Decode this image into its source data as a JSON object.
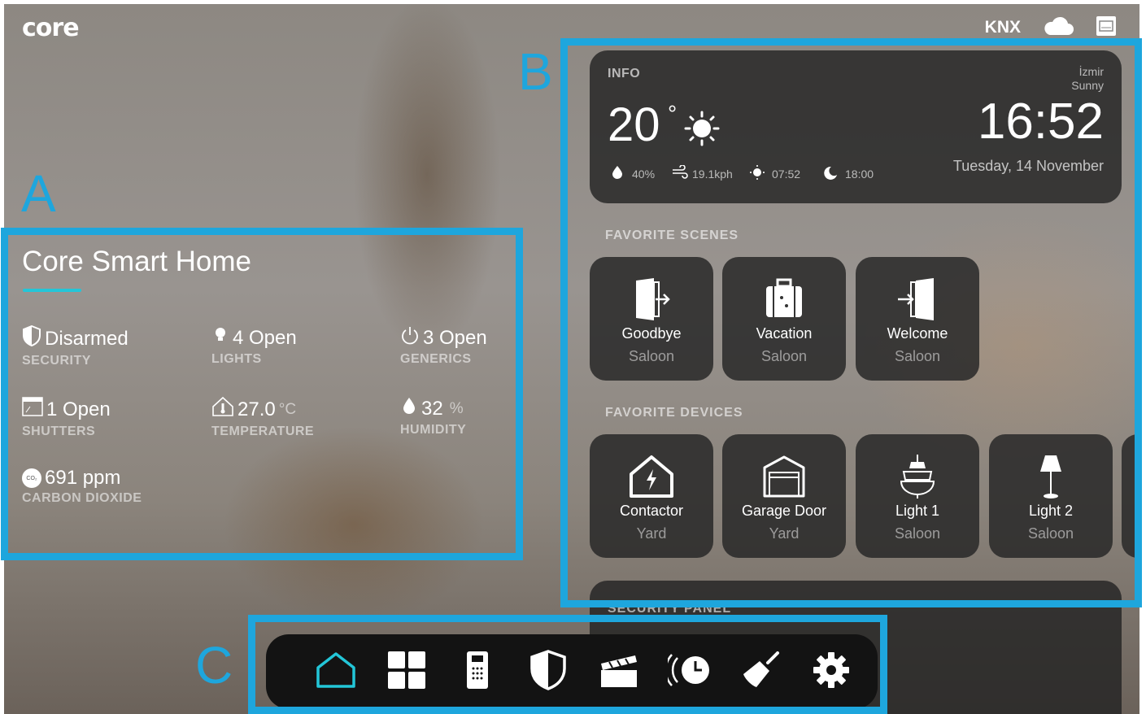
{
  "brand": {
    "logo": "core"
  },
  "status_bar": {
    "protocol": "KNX",
    "cloud_icon": "cloud-icon",
    "device_icon": "screen-icon"
  },
  "annotations": {
    "a": "A",
    "b": "B",
    "c": "C",
    "color": "#1ea6dd"
  },
  "home": {
    "title": "Core Smart Home",
    "accent": "#23c6d8",
    "stats": [
      {
        "value": "Disarmed",
        "unit": "",
        "label": "SECURITY",
        "icon": "shield-icon"
      },
      {
        "value": "4 Open",
        "unit": "",
        "label": "LIGHTS",
        "icon": "bulb-icon"
      },
      {
        "value": "3 Open",
        "unit": "",
        "label": "GENERICS",
        "icon": "power-icon"
      },
      {
        "value": "1 Open",
        "unit": "",
        "label": "SHUTTERS",
        "icon": "shutter-icon"
      },
      {
        "value": "27.0",
        "unit": "°C",
        "label": "TEMPERATURE",
        "icon": "house-thermometer-icon"
      },
      {
        "value": "32",
        "unit": "%",
        "label": "HUMIDITY",
        "icon": "drop-icon"
      },
      {
        "value": "691 ppm",
        "unit": "",
        "label": "CARBON DIOXIDE",
        "icon": "co2-icon",
        "badge": "CO₂"
      }
    ]
  },
  "info": {
    "header": "INFO",
    "city": "İzmir",
    "condition": "Sunny",
    "temperature": "20",
    "degree": "°",
    "humidity": "40%",
    "wind": "19.1kph",
    "sunrise": "07:52",
    "sunset": "18:00",
    "time": "16:52",
    "date": "Tuesday, 14 November"
  },
  "favorite_scenes": {
    "header": "FAVORITE SCENES",
    "items": [
      {
        "name": "Goodbye",
        "location": "Saloon",
        "icon": "door-exit-icon"
      },
      {
        "name": "Vacation",
        "location": "Saloon",
        "icon": "suitcase-icon"
      },
      {
        "name": "Welcome",
        "location": "Saloon",
        "icon": "door-enter-icon"
      }
    ]
  },
  "favorite_devices": {
    "header": "FAVORITE DEVICES",
    "items": [
      {
        "name": "Contactor",
        "location": "Yard",
        "icon": "house-bolt-icon"
      },
      {
        "name": "Garage Door",
        "location": "Yard",
        "icon": "garage-icon"
      },
      {
        "name": "Light 1",
        "location": "Saloon",
        "icon": "chandelier-icon"
      },
      {
        "name": "Light 2",
        "location": "Saloon",
        "icon": "floor-lamp-icon"
      }
    ]
  },
  "security_panel": {
    "header": "SECURITY PANEL"
  },
  "nav": {
    "items": [
      {
        "name": "home",
        "icon": "home-icon",
        "active": true
      },
      {
        "name": "rooms",
        "icon": "grid-icon",
        "active": false
      },
      {
        "name": "intercom",
        "icon": "intercom-icon",
        "active": false
      },
      {
        "name": "security",
        "icon": "shield-icon",
        "active": false
      },
      {
        "name": "scenes",
        "icon": "clapperboard-icon",
        "active": false
      },
      {
        "name": "timers",
        "icon": "clock-waves-icon",
        "active": false
      },
      {
        "name": "cleaning",
        "icon": "broom-icon",
        "active": false
      },
      {
        "name": "settings",
        "icon": "gear-icon",
        "active": false
      }
    ],
    "active_color": "#23c6d8"
  }
}
